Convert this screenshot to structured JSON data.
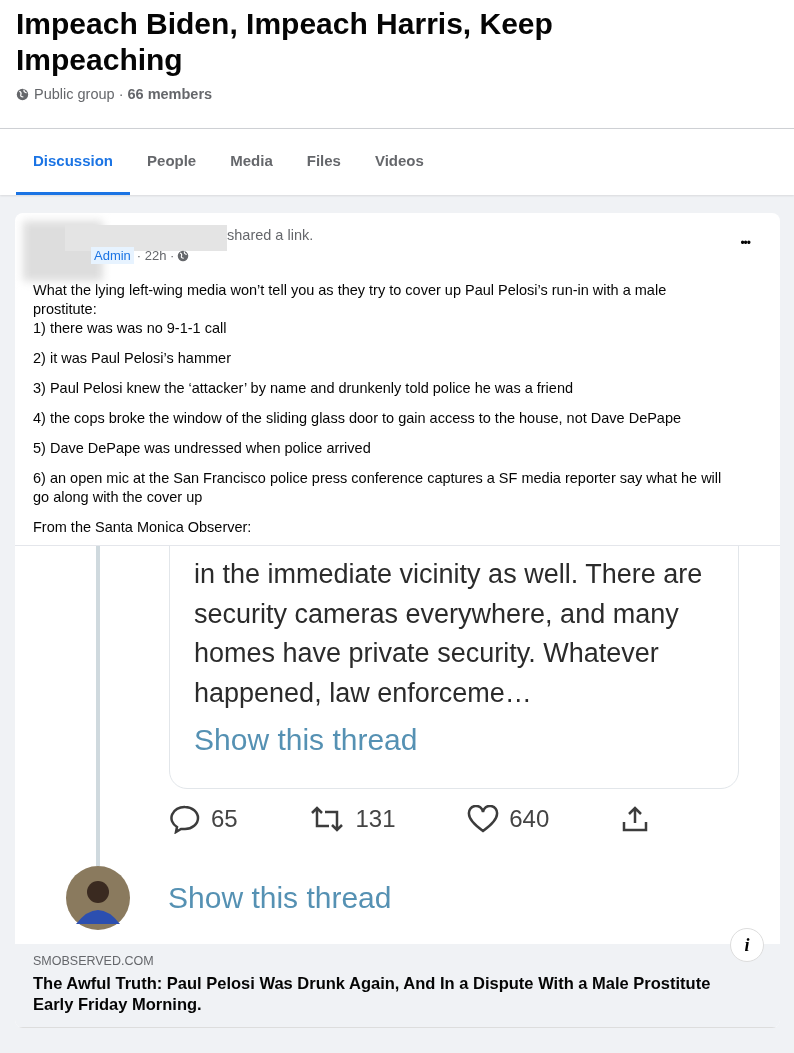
{
  "group": {
    "title": "Impeach Biden, Impeach Harris, Keep Impeaching",
    "privacy": "Public group",
    "separator": " · ",
    "members": "66 members"
  },
  "tabs": [
    {
      "label": "Discussion",
      "selected": true
    },
    {
      "label": "People",
      "selected": false
    },
    {
      "label": "Media",
      "selected": false
    },
    {
      "label": "Files",
      "selected": false
    },
    {
      "label": "Videos",
      "selected": false
    }
  ],
  "post": {
    "action": "shared a link.",
    "badge": "Admin",
    "time": "· 22h ·",
    "more": "•••",
    "paragraphs": [
      "What the lying left-wing media won’t tell you as they try to cover up Paul Pelosi’s run-in with a male prostitute:\n1) there was was no 9-1-1 call",
      "2) it was Paul Pelosi’s hammer",
      "3) Paul Pelosi knew the ‘attacker’ by name and drunkenly told police he was a friend",
      "4) the cops broke the window of the sliding glass door to gain access to the house, not Dave DePape",
      "5) Dave DePape was undressed when police arrived",
      "6) an open mic at the San Francisco police press conference captures a SF media reporter say what he will go along with the cover up",
      "From the Santa Monica Observer:"
    ],
    "embedded_tweet": {
      "text": "in the immediate vicinity as well. There are security cameras everywhere, and many homes have private security. Whatever happened, law enforceme…",
      "thread_link": "Show this thread",
      "replies": "65",
      "retweets": "131",
      "likes": "640",
      "reply_thread_link": "Show this thread"
    },
    "link": {
      "info": "i",
      "domain": "SMOBSERVED.COM",
      "title": "The Awful Truth: Paul Pelosi Was Drunk Again, And In a Dispute With a Male Prostitute Early Friday Morning."
    }
  }
}
